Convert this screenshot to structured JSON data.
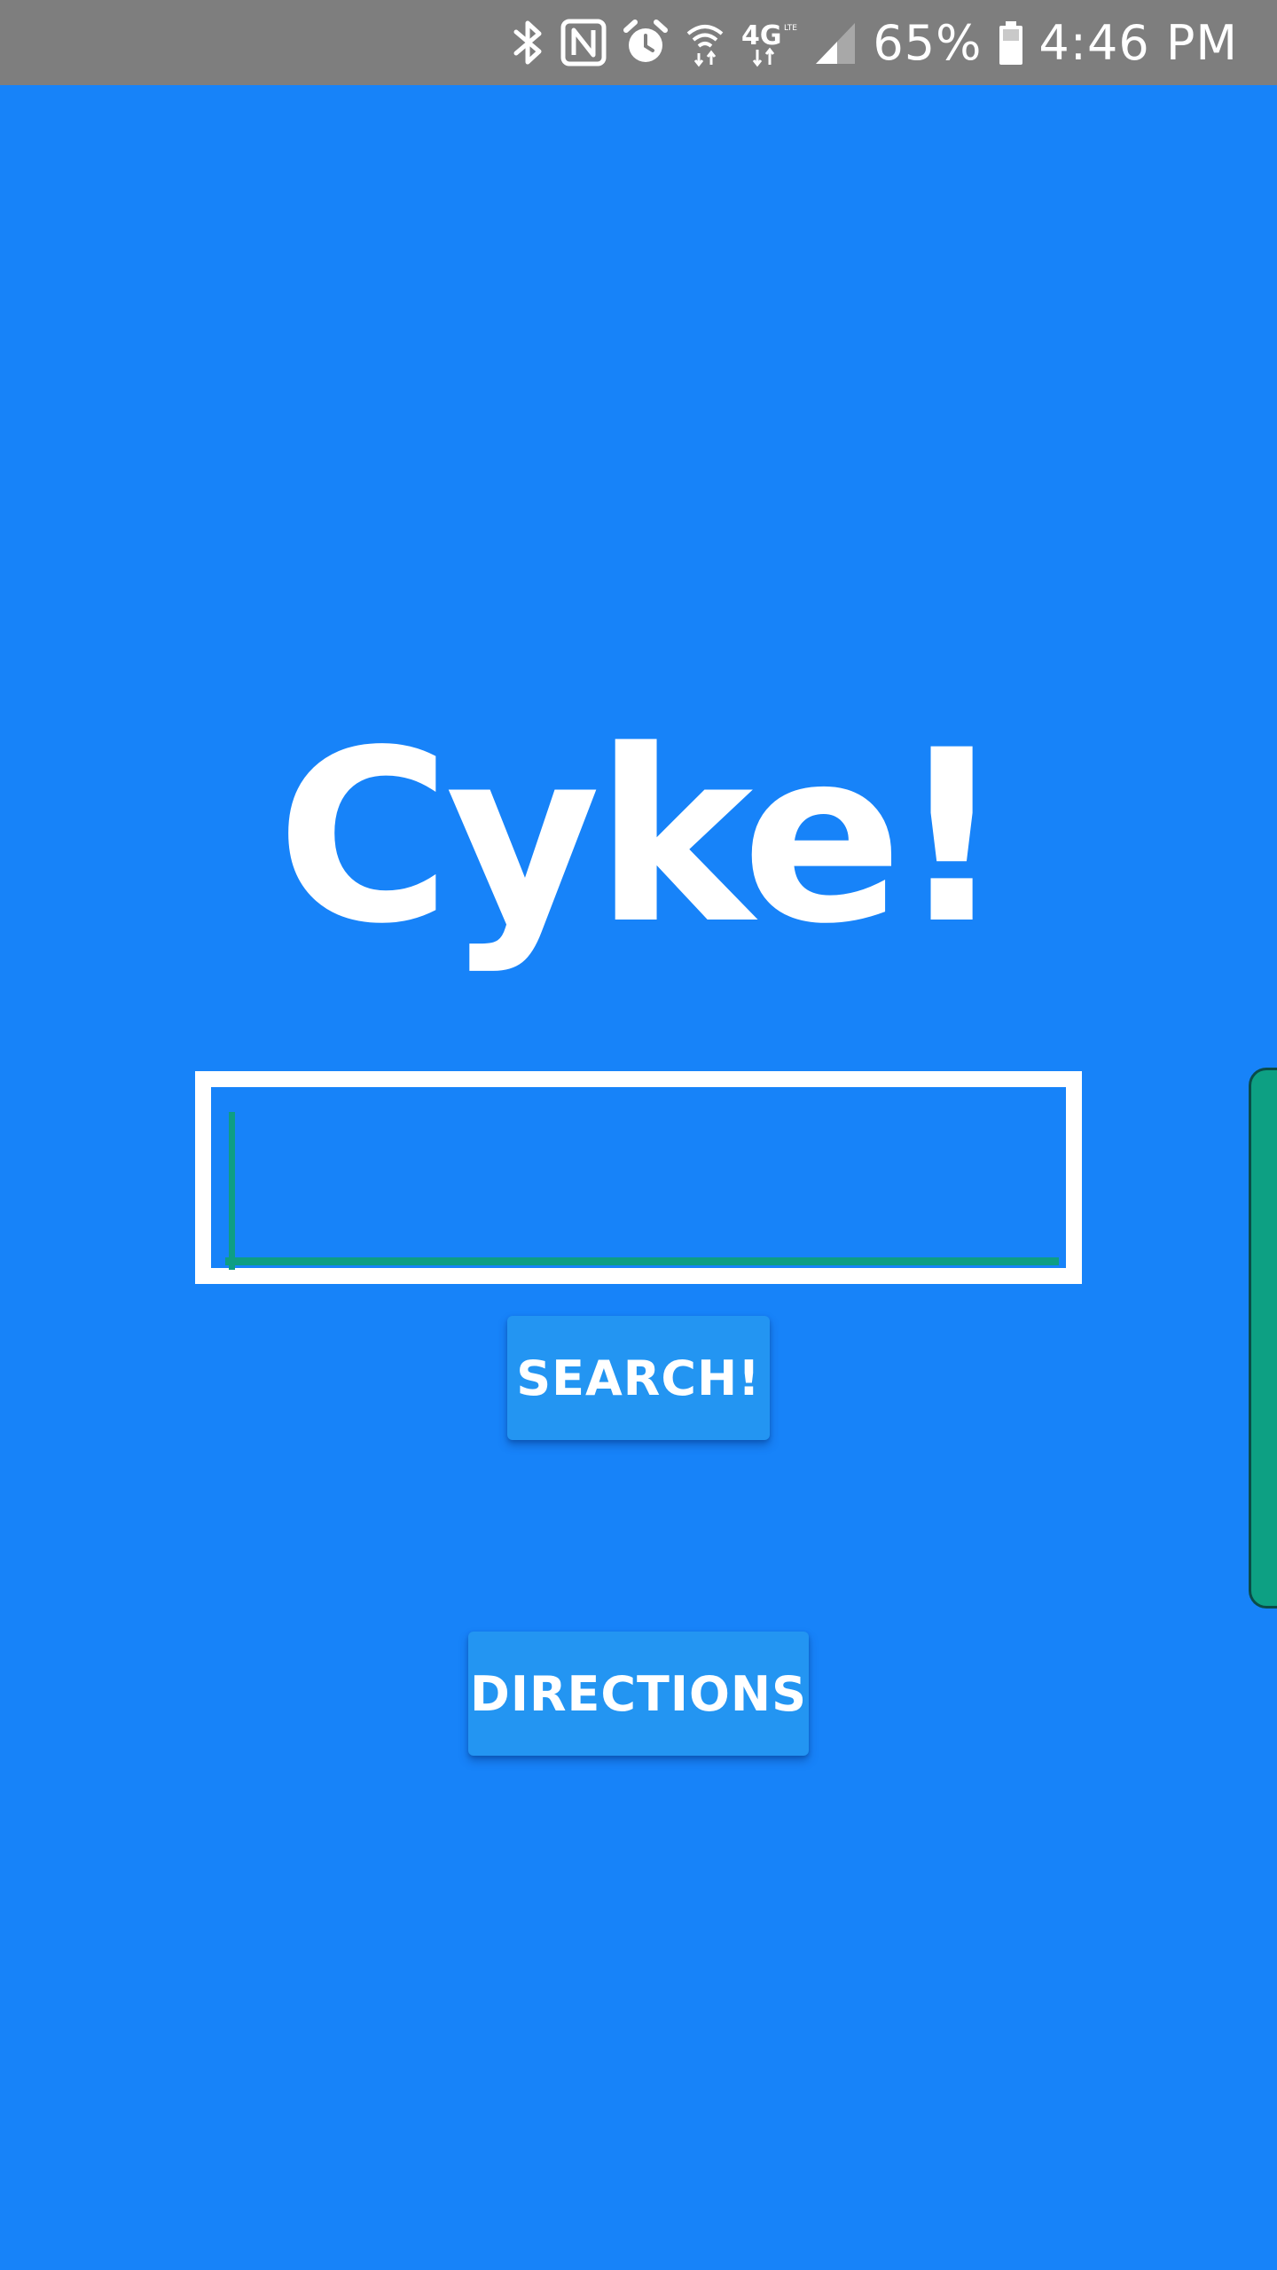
{
  "status_bar": {
    "battery_percent": "65%",
    "time": "4:46 PM",
    "icons": [
      "bluetooth-icon",
      "nfc-icon",
      "alarm-icon",
      "wifi-icon",
      "lte-4g-icon",
      "signal-icon",
      "battery-icon"
    ]
  },
  "app": {
    "title": "Cyke!",
    "search": {
      "value": "",
      "placeholder": ""
    },
    "search_button_label": "SEARCH!",
    "directions_button_label": "DIRECTIONS"
  },
  "colors": {
    "background": "#1783F9",
    "status_bar": "#7E7E7E",
    "button": "#2395F2",
    "accent": "#0E9E84",
    "text": "#FFFFFF"
  }
}
